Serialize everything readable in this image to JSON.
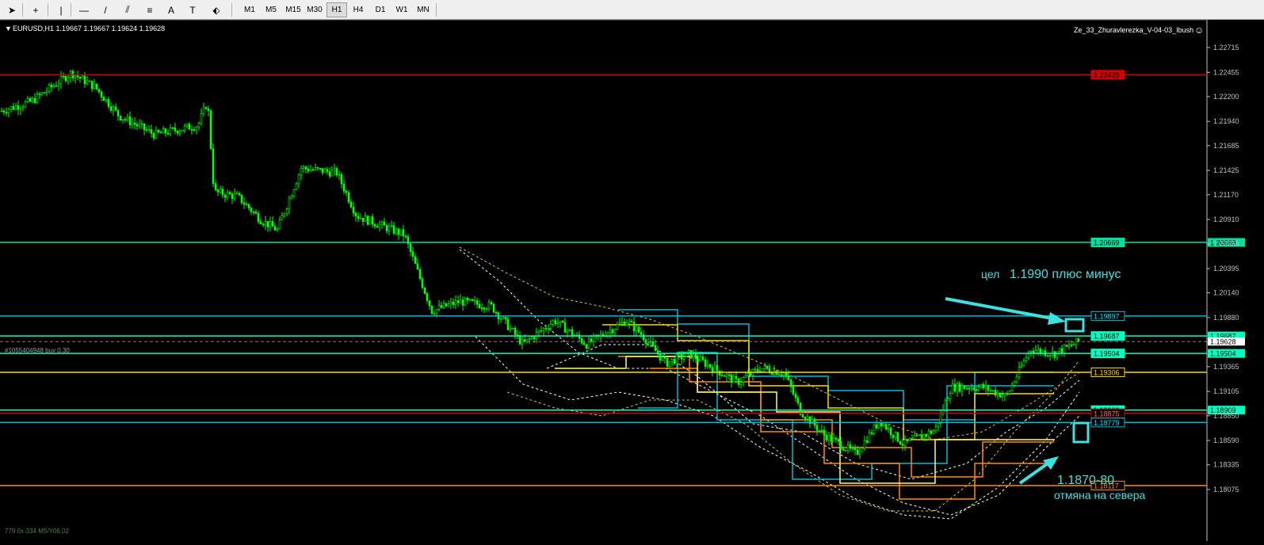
{
  "toolbar": {
    "tools": [
      {
        "name": "cursor-icon",
        "glyph": "➤"
      },
      {
        "name": "crosshair-icon",
        "glyph": "+"
      },
      {
        "name": "vertical-line-icon",
        "glyph": "|"
      },
      {
        "name": "horizontal-line-icon",
        "glyph": "—"
      },
      {
        "name": "trendline-icon",
        "glyph": "/"
      },
      {
        "name": "fibonacci-fan-icon",
        "glyph": "⫽"
      },
      {
        "name": "fibonacci-retracement-icon",
        "glyph": "≡"
      },
      {
        "name": "text-tool-icon",
        "glyph": "A"
      },
      {
        "name": "text-label-icon",
        "glyph": "T"
      },
      {
        "name": "shapes-dropdown-icon",
        "glyph": "⬖"
      }
    ],
    "timeframes": [
      "M1",
      "M5",
      "M15",
      "M30",
      "H1",
      "H4",
      "D1",
      "W1",
      "MN"
    ],
    "active_timeframe": "H1"
  },
  "header": {
    "symbol_info": "EURUSD,H1  1.19667 1.19667 1.19624 1.19628",
    "indicator_name": "Ze_33_Zhuravlerezka_V-04-03_Ibush",
    "smiley": "☺"
  },
  "order_label": "#1055404948 buy 0.30",
  "bottom_left_label": "779  0x-334  M5/Y06.02",
  "price_axis": {
    "ticks": [
      "1.22715",
      "1.22455",
      "1.22200",
      "1.21940",
      "1.21685",
      "1.21425",
      "1.21170",
      "1.20910",
      "1.20655",
      "1.20395",
      "1.20140",
      "1.19880",
      "1.19620",
      "1.19365",
      "1.19105",
      "1.18850",
      "1.18590",
      "1.18335",
      "1.18075"
    ],
    "current_price": "1.19628"
  },
  "price_lines": [
    {
      "label": "1.22429",
      "color": "#d00000",
      "text_color": "#ffffff"
    },
    {
      "label": "1.20669",
      "color": "#00e0a0",
      "text_color": "#000000"
    },
    {
      "label": "1.19897",
      "color": "#00bcd4",
      "text_color": "#00e5ff"
    },
    {
      "label": "1.19687",
      "color": "#00ffc0",
      "text_color": "#000000"
    },
    {
      "label": "1.19504",
      "color": "#00ffc0",
      "text_color": "#000000"
    },
    {
      "label": "1.19306",
      "color": "#ffd700",
      "text_color": "#ffd700"
    },
    {
      "label": "1.18909",
      "color": "#00ffc0",
      "text_color": "#000000"
    },
    {
      "label": "1.18875",
      "color": "#d00000",
      "text_color": "#ff6060"
    },
    {
      "label": "1.18779",
      "color": "#00bcd4",
      "text_color": "#00e5ff"
    },
    {
      "label": "1.18117",
      "color": "#ff8c00",
      "text_color": "#ff8c00"
    }
  ],
  "annotations": {
    "target_prefix": "цел",
    "target_text": "1.1990 плюс минус",
    "cancel_level": "1.1870-80",
    "cancel_text": "отмяна на севера"
  },
  "colors": {
    "background": "#000000",
    "candles": "#00ff00",
    "annotation": "#40e0e0",
    "axis_text": "#c0c0c0"
  }
}
